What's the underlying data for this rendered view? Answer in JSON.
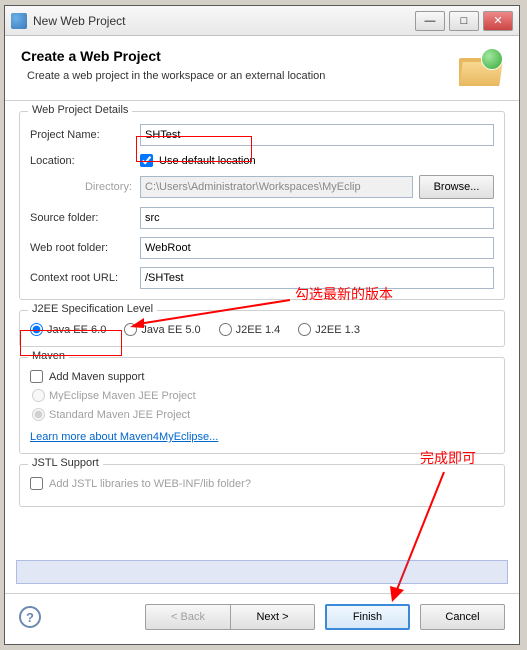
{
  "window": {
    "title": "New Web Project"
  },
  "banner": {
    "title": "Create a Web Project",
    "desc": "Create a web project in the workspace or an external location"
  },
  "details": {
    "group_title": "Web Project Details",
    "project_name_label": "Project Name:",
    "project_name_value": "SHTest",
    "location_label": "Location:",
    "use_default_label": "Use default location",
    "use_default_checked": true,
    "directory_label": "Directory:",
    "directory_value": "C:\\Users\\Administrator\\Workspaces\\MyEclip",
    "browse_label": "Browse...",
    "source_folder_label": "Source folder:",
    "source_folder_value": "src",
    "web_root_label": "Web root folder:",
    "web_root_value": "WebRoot",
    "context_root_label": "Context root URL:",
    "context_root_value": "/SHTest"
  },
  "j2ee": {
    "group_title": "J2EE Specification Level",
    "options": [
      {
        "label": "Java EE 6.0",
        "checked": true
      },
      {
        "label": "Java EE 5.0",
        "checked": false
      },
      {
        "label": "J2EE 1.4",
        "checked": false
      },
      {
        "label": "J2EE 1.3",
        "checked": false
      }
    ]
  },
  "maven": {
    "group_title": "Maven",
    "add_support_label": "Add Maven support",
    "add_support_checked": false,
    "myeclipse_label": "MyEclipse Maven JEE Project",
    "standard_label": "Standard Maven JEE Project",
    "standard_checked": true,
    "link_label": "Learn more about Maven4MyEclipse..."
  },
  "jstl": {
    "group_title": "JSTL Support",
    "add_label": "Add JSTL libraries to WEB-INF/lib folder?",
    "add_checked": false
  },
  "footer": {
    "back": "< Back",
    "next": "Next >",
    "finish": "Finish",
    "cancel": "Cancel"
  },
  "annotations": {
    "check_latest": "勾选最新的版本",
    "finish_ok": "完成即可"
  }
}
